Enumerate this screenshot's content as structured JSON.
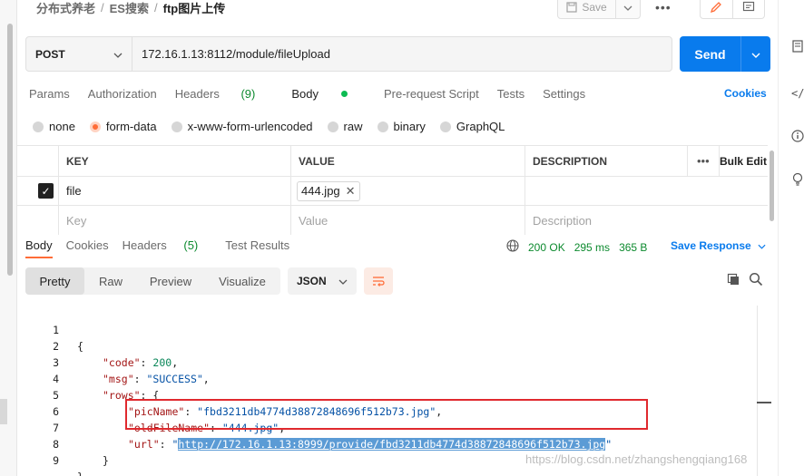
{
  "breadcrumb": {
    "part1": "分布式养老",
    "part2": "ES搜索",
    "current": "ftp图片上传",
    "separator": "/"
  },
  "toolbar": {
    "save_label": "Save",
    "more_label": "•••"
  },
  "request": {
    "method": "POST",
    "url": "172.16.1.13:8112/module/fileUpload",
    "send_label": "Send"
  },
  "req_tabs": {
    "params": "Params",
    "authorization": "Authorization",
    "headers": "Headers",
    "headers_count": "(9)",
    "body": "Body",
    "prerequest": "Pre-request Script",
    "tests": "Tests",
    "settings": "Settings",
    "cookies": "Cookies"
  },
  "body_types": {
    "none": "none",
    "form_data": "form-data",
    "urlencoded": "x-www-form-urlencoded",
    "raw": "raw",
    "binary": "binary",
    "graphql": "GraphQL",
    "selected": "form-data"
  },
  "params_table": {
    "headers": {
      "key": "KEY",
      "value": "VALUE",
      "description": "DESCRIPTION",
      "more": "•••",
      "bulk_edit": "Bulk Edit"
    },
    "rows": [
      {
        "checked": true,
        "key": "file",
        "value": "444.jpg",
        "description": ""
      }
    ],
    "placeholders": {
      "key": "Key",
      "value": "Value",
      "description": "Description"
    }
  },
  "resp_tabs": {
    "body": "Body",
    "cookies": "Cookies",
    "headers": "Headers",
    "headers_count": "(5)",
    "test_results": "Test Results"
  },
  "status": {
    "code": "200 OK",
    "time": "295 ms",
    "size": "365 B",
    "save_response": "Save Response"
  },
  "view_tabs": {
    "pretty": "Pretty",
    "raw": "Raw",
    "preview": "Preview",
    "visualize": "Visualize",
    "format": "JSON"
  },
  "code": {
    "l1": "{",
    "l2_key": "\"code\"",
    "l2_val": "200",
    "l3_key": "\"msg\"",
    "l3_val": "\"SUCCESS\"",
    "l4_key": "\"rows\"",
    "l4_val": "{",
    "l5_key": "\"picName\"",
    "l5_val": "\"fbd3211db4774d38872848696f512b73.jpg\"",
    "l6_key": "\"oldFileName\"",
    "l6_val": "\"444.jpg\"",
    "l7_key": "\"url\"",
    "l7_q": "\"",
    "l7_val": "http://172.16.1.13:8999/provide/fbd3211db4774d38872848696f512b73.jpg",
    "l7_q2": "\"",
    "l8": "}",
    "l9": "}"
  },
  "watermark": "https://blog.csdn.net/zhangshengqiang168",
  "colors": {
    "accent": "#ff6c37",
    "send": "#097bed",
    "status_ok": "#0c8a2e",
    "highlight_box": "#e0292e"
  }
}
